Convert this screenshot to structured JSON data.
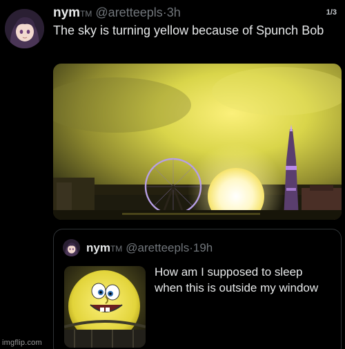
{
  "tweet": {
    "display_name": "nym",
    "tm": "TM",
    "handle": "@aretteepls",
    "separator": "·",
    "time": "3h",
    "page_count": "1/3",
    "text": "The sky is turning yellow because of Spunch Bob",
    "media_icon": "photo-london-eye-glowing-sphere-yellow-sky"
  },
  "quoted_tweet": {
    "display_name": "nym",
    "tm": "TM",
    "handle": "@aretteepls",
    "separator": "·",
    "time": "19h",
    "text": "How am I supposed to sleep when this is outside my window",
    "thumb_icon": "photo-sphere-with-spongebob-face"
  },
  "watermark": "imgflip.com",
  "colors": {
    "background": "#000000",
    "text_primary": "#e7e9ea",
    "text_secondary": "#71767b",
    "border": "#2f3336",
    "sky_yellow": "#d9d54a",
    "sphere_glow": "#fff8c8"
  }
}
